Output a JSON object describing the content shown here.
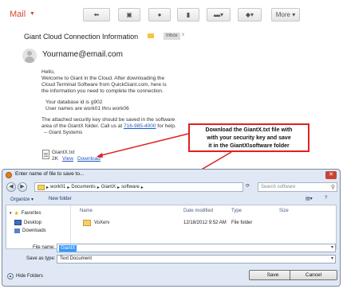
{
  "gmail": {
    "mail_label": "Mail",
    "more_label": "More",
    "subject": "Giant Cloud Connection Information",
    "inbox_tag": "Inbox",
    "inbox_tag_close": "x",
    "sender": "Yourname@email.com",
    "body_lines": [
      "Hello,",
      "Welcome to Giant in the Cloud. After downloading the",
      "Cloud Terminal Software from QuickGiant.com, here is",
      "the information you need to complete the connection.",
      "",
      "Your database id is g902",
      "User names are work01 thru work06",
      "",
      "The attached security key should be saved in the software",
      "area of the GiantX folder. Call us at",
      "-- Giant Systems"
    ],
    "phone_link": "716-985-4000",
    "phone_suffix": " for help.",
    "attachment_name": "GiantX.txt",
    "attachment_size": "2K",
    "view_link": "View",
    "download_link": "Download",
    "accent_color": "#d14836"
  },
  "callout": {
    "text": "Download the GiantX.txt file with\nwith your security key and save\nit in the GiantX\\software folder",
    "border_color": "#e02020"
  },
  "dialog": {
    "title": "Enter name of file to save to...",
    "breadcrumb": [
      "work01",
      "Documents",
      "GiantX",
      "software"
    ],
    "search_placeholder": "Search software",
    "organize_label": "Organize",
    "new_folder_label": "New folder",
    "nav": {
      "favorites": "Favorites",
      "desktop": "Desktop",
      "downloads": "Downloads"
    },
    "columns": [
      "Name",
      "Date modified",
      "Type",
      "Size"
    ],
    "rows": [
      {
        "name": "VoXerv",
        "date": "12/18/2012 9:52 AM",
        "type": "File folder",
        "size": ""
      }
    ],
    "file_name_label": "File name:",
    "file_name_value": "GiantX",
    "save_as_label": "Save as type:",
    "save_as_value": "Text Document",
    "hide_folders": "Hide Folders",
    "save_button": "Save",
    "cancel_button": "Cancel"
  }
}
